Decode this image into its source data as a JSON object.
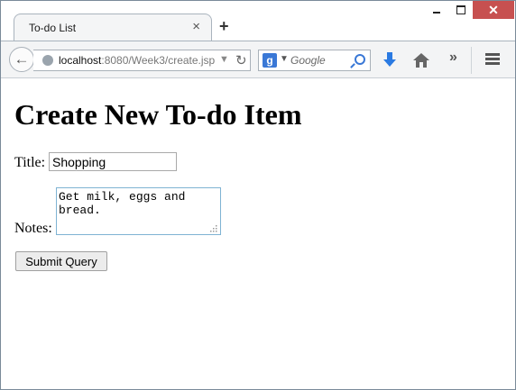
{
  "window": {
    "tab_title": "To-do List",
    "tab_close": "×",
    "new_tab": "+",
    "close_glyph": "✕"
  },
  "nav": {
    "url_host": "localhost",
    "url_path": ":8080/Week3/create.jsp",
    "search_placeholder": "Google",
    "search_engine_letter": "g"
  },
  "page": {
    "heading": "Create New To-do Item",
    "title_label": "Title:",
    "title_value": "Shopping",
    "notes_label": "Notes:",
    "notes_value": "Get milk, eggs and bread.",
    "submit_label": "Submit Query"
  },
  "icons": [
    "back-arrow-icon",
    "globe-icon",
    "reload-icon",
    "search-icon",
    "download-icon",
    "home-icon",
    "overflow-icon",
    "hamburger-menu-icon"
  ],
  "colors": {
    "close_button": "#c75050",
    "accent_blue": "#3a78d6",
    "textarea_focus": "#7fb3d3"
  }
}
